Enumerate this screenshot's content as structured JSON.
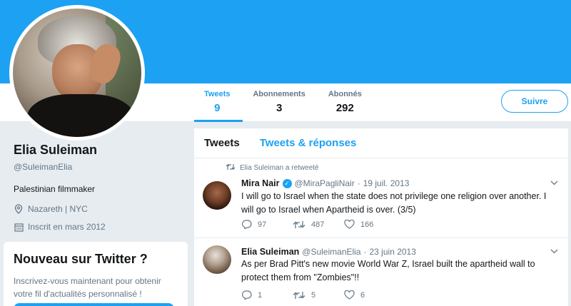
{
  "profile": {
    "name": "Elia Suleiman",
    "handle": "@SuleimanElia",
    "bio": "Palestinian filmmaker",
    "location": "Nazareth | NYC",
    "joined": "Inscrit en mars 2012"
  },
  "stats": [
    {
      "label": "Tweets",
      "value": "9"
    },
    {
      "label": "Abonnements",
      "value": "3"
    },
    {
      "label": "Abonnés",
      "value": "292"
    }
  ],
  "follow_label": "Suivre",
  "signup": {
    "title": "Nouveau sur Twitter ?",
    "text": "Inscrivez-vous maintenant pour obtenir votre fil d'actualités personnalisé !"
  },
  "timeline": {
    "tabs": [
      "Tweets",
      "Tweets & réponses"
    ],
    "tweets": [
      {
        "retweet_context": "Elia Suleiman a retweeté",
        "name": "Mira Nair",
        "handle": "@MiraPagliNair",
        "sep": "·",
        "date": "19 juil. 2013",
        "text": "I will go to Israel when the state does not privilege one religion over another. I will go to Israel when Apartheid is over. (3/5)",
        "replies": "97",
        "retweets": "487",
        "likes": "166"
      },
      {
        "name": "Elia Suleiman",
        "handle": "@SuleimanElia",
        "sep": "·",
        "date": "23 juin 2013",
        "text": "As per Brad Pitt's new movie World War Z,  Israel built the apartheid wall to protect them from \"Zombies\"!!",
        "replies": "1",
        "retweets": "5",
        "likes": "6"
      }
    ]
  },
  "colors": {
    "accent": "#1da1f2",
    "background": "#e6ecf0",
    "muted": "#657786"
  },
  "icons": [
    "location-pin-icon",
    "calendar-icon",
    "retweet-icon",
    "verified-badge-icon",
    "reply-icon",
    "like-icon",
    "caret-down-icon"
  ]
}
